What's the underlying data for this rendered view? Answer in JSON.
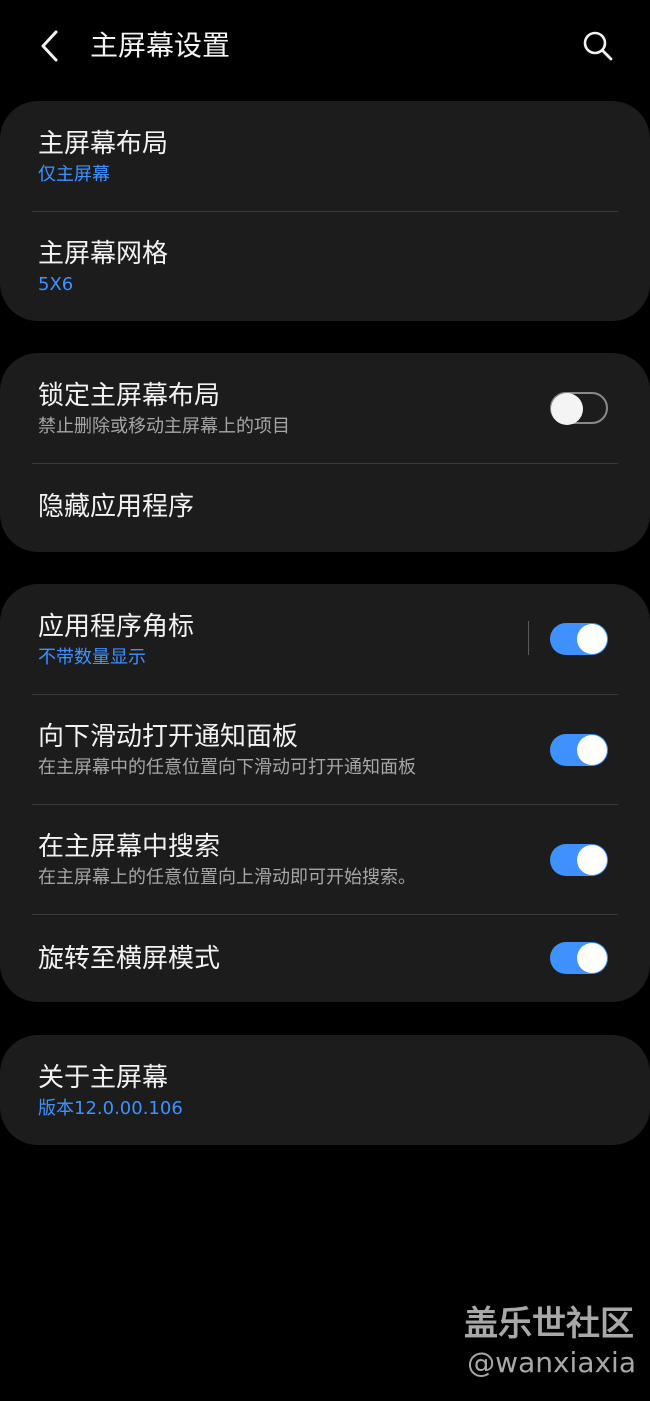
{
  "header": {
    "title": "主屏幕设置",
    "back_icon": "chevron-left-icon",
    "search_icon": "search-icon"
  },
  "colors": {
    "accent": "#3e91ff",
    "card": "#1c1c1c",
    "background": "#000000"
  },
  "layout_card": {
    "layout": {
      "title": "主屏幕布局",
      "value": "仅主屏幕"
    },
    "grid": {
      "title": "主屏幕网格",
      "value": "5X6"
    }
  },
  "lock_card": {
    "lock_layout": {
      "title": "锁定主屏幕布局",
      "desc": "禁止删除或移动主屏幕上的项目",
      "enabled": false
    },
    "hide_apps": {
      "title": "隐藏应用程序"
    }
  },
  "features_card": {
    "app_badges": {
      "title": "应用程序角标",
      "value": "不带数量显示",
      "enabled": true
    },
    "swipe_notifications": {
      "title": "向下滑动打开通知面板",
      "desc": "在主屏幕中的任意位置向下滑动可打开通知面板",
      "enabled": true
    },
    "home_search": {
      "title": "在主屏幕中搜索",
      "desc": "在主屏幕上的任意位置向上滑动即可开始搜索。",
      "enabled": true
    },
    "rotate_landscape": {
      "title": "旋转至横屏模式",
      "enabled": true
    }
  },
  "about_card": {
    "about": {
      "title": "关于主屏幕",
      "version": "版本12.0.00.106"
    }
  },
  "watermark": {
    "line1": "盖乐世社区",
    "line2": "@wanxiaxia"
  }
}
